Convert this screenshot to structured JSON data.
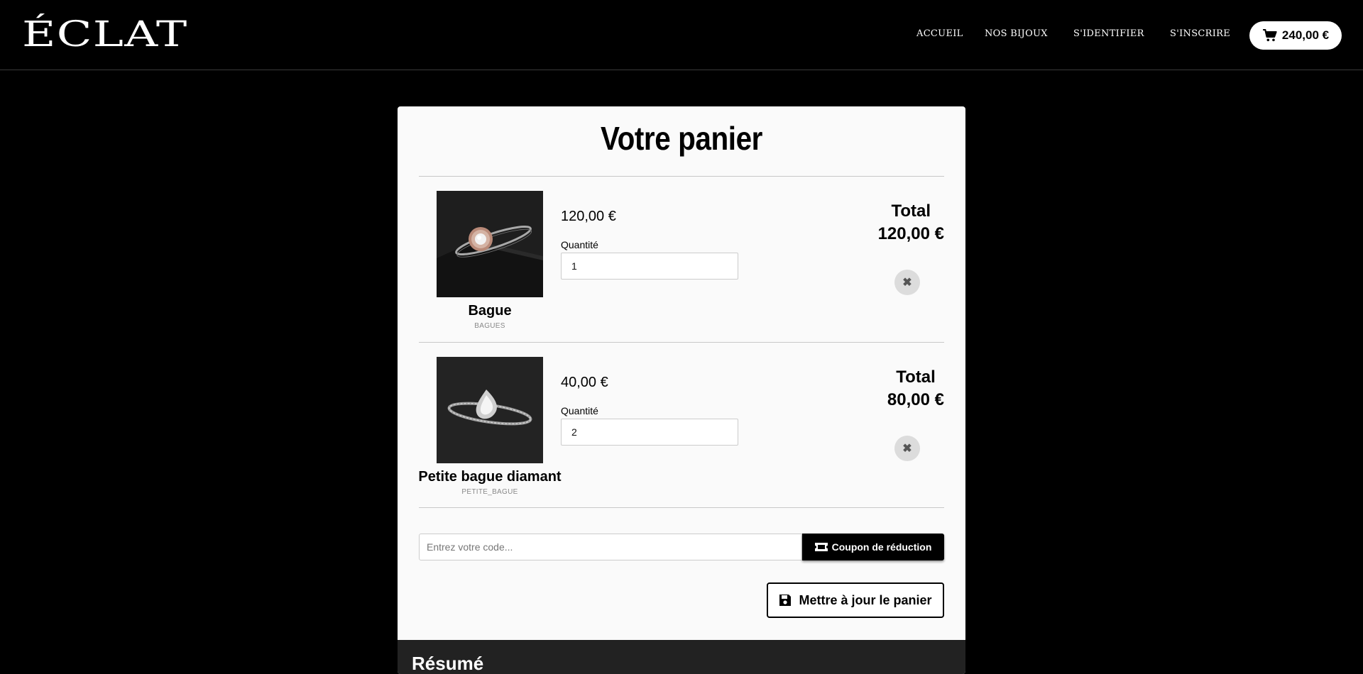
{
  "header": {
    "logo": "ÉCLAT",
    "nav": [
      {
        "label": "ACCUEIL"
      },
      {
        "label": "NOS BIJOUX"
      },
      {
        "label": "S'IDENTIFIER"
      },
      {
        "label": "S'INSCRIRE"
      }
    ],
    "cart_total": "240,00 €",
    "cart_icon": "shopping-cart-icon"
  },
  "cart": {
    "title": "Votre panier",
    "items": [
      {
        "name": "Bague",
        "category": "BAGUES",
        "unit_price": "120,00 €",
        "quantity_label": "Quantité",
        "quantity": "1",
        "total_label": "Total",
        "total": "120,00 €",
        "remove_icon": "close-icon"
      },
      {
        "name": "Petite bague diamant",
        "category": "PETITE_BAGUE",
        "unit_price": "40,00 €",
        "quantity_label": "Quantité",
        "quantity": "2",
        "total_label": "Total",
        "total": "80,00 €",
        "remove_icon": "close-icon"
      }
    ],
    "coupon": {
      "placeholder": "Entrez votre code...",
      "button_label": "Coupon de réduction",
      "button_icon": "ticket-icon"
    },
    "update_button": {
      "label": "Mettre à jour le panier",
      "icon": "save-icon"
    },
    "summary_title": "Résumé"
  },
  "colors": {
    "page_background": "#000000",
    "card_background": "#fafafa",
    "summary_background": "#222222",
    "accent": "#000000"
  }
}
